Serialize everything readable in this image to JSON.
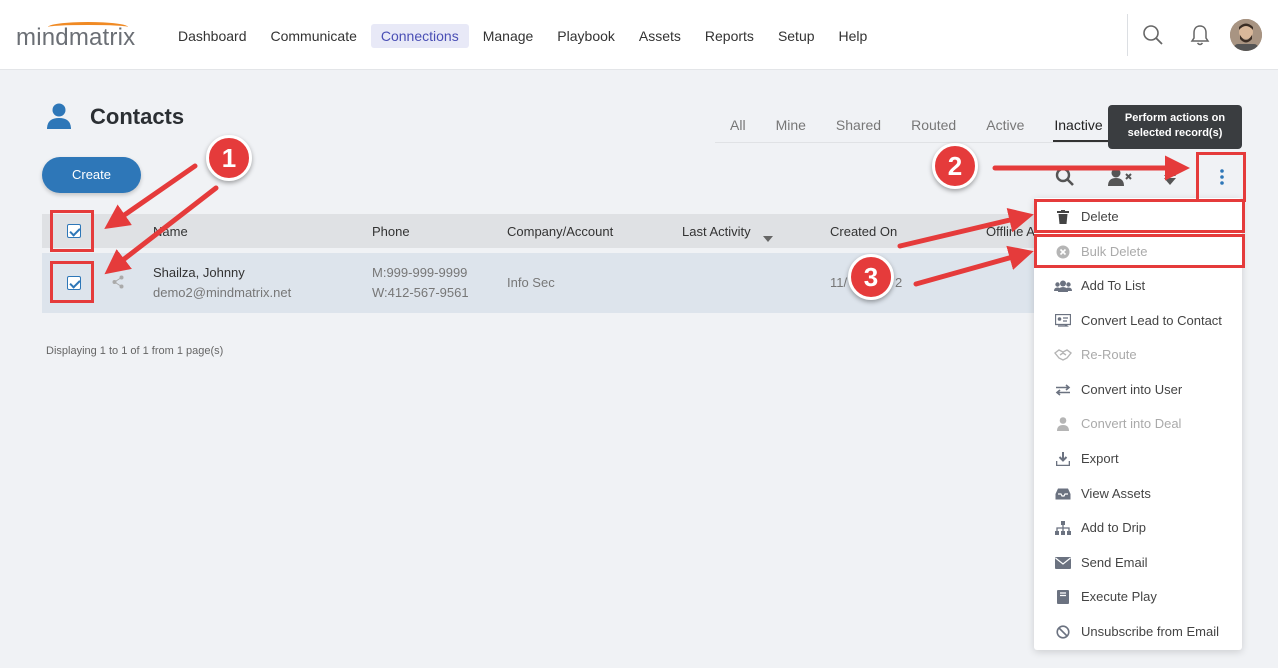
{
  "logo": "mindmatrix",
  "nav": [
    "Dashboard",
    "Communicate",
    "Connections",
    "Manage",
    "Playbook",
    "Assets",
    "Reports",
    "Setup",
    "Help"
  ],
  "page_title": "Contacts",
  "tabs": [
    "All",
    "Mine",
    "Shared",
    "Routed",
    "Active",
    "Inactive"
  ],
  "create_label": "Create",
  "tooltip": "Perform actions on selected record(s)",
  "columns": {
    "name": "Name",
    "phone": "Phone",
    "company": "Company/Account",
    "last_activity": "Last Activity",
    "created_on": "Created On",
    "offline": "Offline A"
  },
  "row": {
    "name": "Shailza, Johnny",
    "email": "demo2@mindmatrix.net",
    "phone_mobile": "M:999-999-9999",
    "phone_work": "W:412-567-9561",
    "company": "Info Sec",
    "created_start": "11/",
    "created_end": "2"
  },
  "display_info": "Displaying 1 to 1 of 1 from 1 page(s)",
  "menu": {
    "delete": "Delete",
    "bulk_delete": "Bulk Delete",
    "add_to_list": "Add To List",
    "convert_lead": "Convert Lead to Contact",
    "re_route": "Re-Route",
    "convert_user": "Convert into User",
    "convert_deal": "Convert into Deal",
    "export": "Export",
    "view_assets": "View Assets",
    "add_to_drip": "Add to Drip",
    "send_email": "Send Email",
    "execute_play": "Execute Play",
    "unsubscribe": "Unsubscribe from Email"
  },
  "badges": [
    "1",
    "2",
    "3"
  ],
  "colors": {
    "accent": "#2e77b8",
    "annotation": "#e53b3b",
    "logo_arc": "#f08a24"
  }
}
